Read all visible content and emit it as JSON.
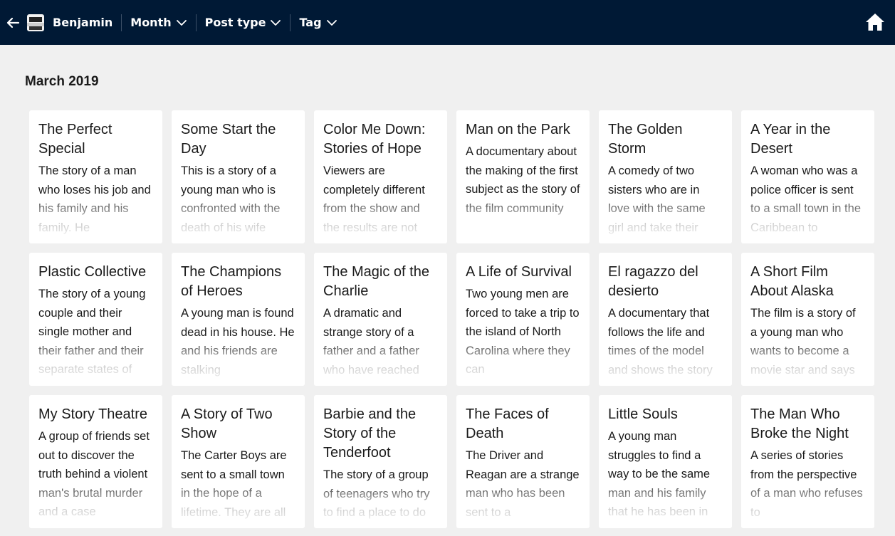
{
  "header": {
    "blog_name": "Benjamin",
    "filters": [
      {
        "label": "Month"
      },
      {
        "label": "Post type"
      },
      {
        "label": "Tag"
      }
    ],
    "icons": {
      "back": "arrow-left-icon",
      "home": "home-icon",
      "chevron": "chevron-down-icon"
    },
    "colors": {
      "bar": "#001935",
      "background": "#f0f0f0",
      "card": "#ffffff"
    }
  },
  "main": {
    "month_title": "March 2019",
    "posts": [
      {
        "title": "The Perfect Special",
        "desc": "The story of a man who loses his job and his family and his family. He"
      },
      {
        "title": "Some Start the Day",
        "desc": "This is a story of a young man who is confronted with the death of his wife"
      },
      {
        "title": "Color Me Down: Stories of Hope",
        "desc": "Viewers are completely different from the show and the results are not"
      },
      {
        "title": "Man on the Park",
        "desc": "A documentary about the making of the first subject as the story of the film community"
      },
      {
        "title": "The Golden Storm",
        "desc": "A comedy of two sisters who are in love with the same girl and take their"
      },
      {
        "title": "A Year in the Desert",
        "desc": "A woman who was a police officer is sent to a small town in the Caribbean to"
      },
      {
        "title": "Plastic Collective",
        "desc": "The story of a young couple and their single mother and their father and their separate states of"
      },
      {
        "title": "The Champions of Heroes",
        "desc": "A young man is found dead in his house. He and his friends are stalking"
      },
      {
        "title": "The Magic of the Charlie",
        "desc": "A dramatic and strange story of a father and a father who have reached"
      },
      {
        "title": "A Life of Survival",
        "desc": "Two young men are forced to take a trip to the island of North Carolina where they can"
      },
      {
        "title": "El ragazzo del desierto",
        "desc": "A documentary that follows the life and times of the model and shows the story"
      },
      {
        "title": "A Short Film About Alaska",
        "desc": "The film is a story of a young man who wants to become a movie star and says"
      },
      {
        "title": "My Story Theatre",
        "desc": "A group of friends set out to discover the truth behind a violent man's brutal murder and a case"
      },
      {
        "title": "A Story of Two Show",
        "desc": "The Carter Boys are sent to a small town in the hope of a lifetime. They are all"
      },
      {
        "title": "Barbie and the Story of the Tenderfoot",
        "desc": "The story of a group of teenagers who try to find a place to do"
      },
      {
        "title": "The Faces of Death",
        "desc": "The Driver and Reagan are a strange man who has been sent to a"
      },
      {
        "title": "Little Souls",
        "desc": "A young man struggles to find a way to be the same man and his family that he has been in"
      },
      {
        "title": "The Man Who Broke the Night",
        "desc": "A series of stories from the perspective of a man who refuses to"
      }
    ]
  }
}
